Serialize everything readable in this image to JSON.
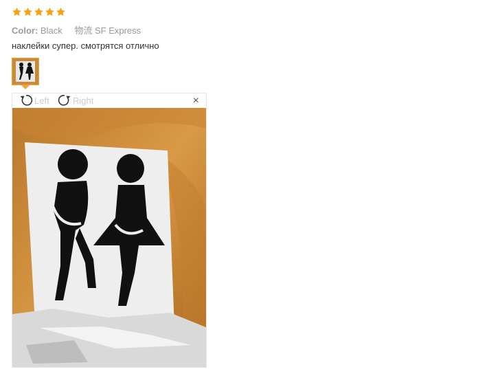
{
  "rating": {
    "stars": 5,
    "max": 5,
    "color": "#f5a00c"
  },
  "meta": {
    "color_label": "Color:",
    "color_value": "Black",
    "shipping_label": "物流",
    "shipping_value": "SF Express"
  },
  "review": {
    "text": "наклейки супер. смотрятся отлично"
  },
  "viewer": {
    "rotate_left": "Left",
    "rotate_right": "Right",
    "close": "×"
  },
  "colors": {
    "accent": "#f2a33c",
    "text": "#333333",
    "muted": "#999999"
  }
}
